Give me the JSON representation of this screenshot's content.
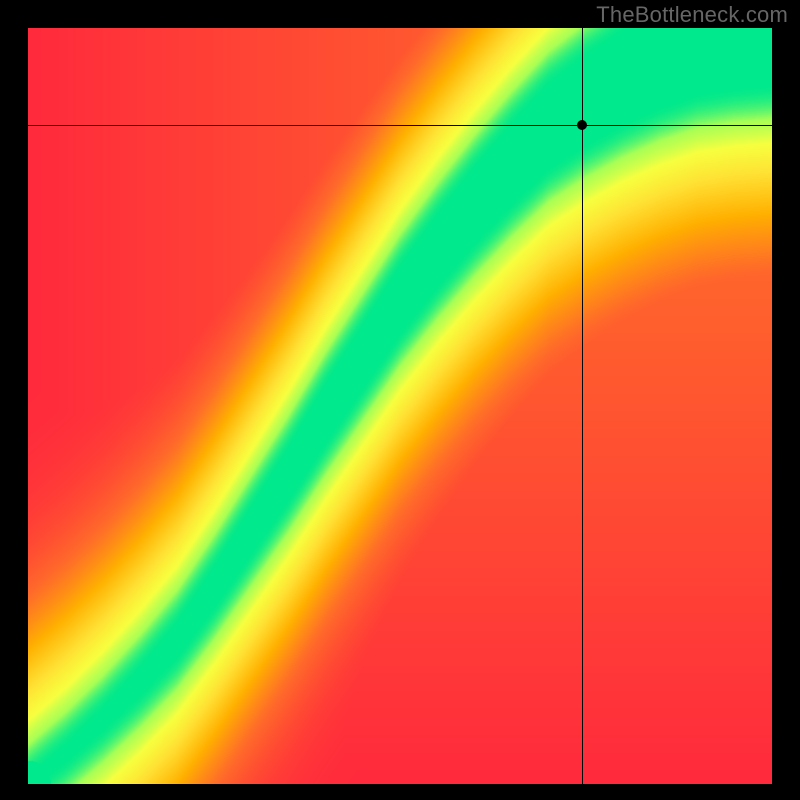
{
  "watermark": "TheBottleneck.com",
  "chart_data": {
    "type": "heatmap",
    "title": "",
    "xlabel": "",
    "ylabel": "",
    "xlim": [
      0,
      1
    ],
    "ylim": [
      0,
      1
    ],
    "crosshair": {
      "x": 0.745,
      "y": 0.872
    },
    "marker": {
      "x": 0.745,
      "y": 0.872
    },
    "optimal_ridge": [
      {
        "x": 0.0,
        "y": 0.0
      },
      {
        "x": 0.05,
        "y": 0.04
      },
      {
        "x": 0.1,
        "y": 0.085
      },
      {
        "x": 0.15,
        "y": 0.135
      },
      {
        "x": 0.2,
        "y": 0.19
      },
      {
        "x": 0.25,
        "y": 0.26
      },
      {
        "x": 0.3,
        "y": 0.335
      },
      {
        "x": 0.35,
        "y": 0.41
      },
      {
        "x": 0.4,
        "y": 0.49
      },
      {
        "x": 0.45,
        "y": 0.565
      },
      {
        "x": 0.5,
        "y": 0.64
      },
      {
        "x": 0.55,
        "y": 0.705
      },
      {
        "x": 0.6,
        "y": 0.765
      },
      {
        "x": 0.65,
        "y": 0.82
      },
      {
        "x": 0.7,
        "y": 0.87
      },
      {
        "x": 0.75,
        "y": 0.905
      },
      {
        "x": 0.8,
        "y": 0.935
      },
      {
        "x": 0.85,
        "y": 0.96
      },
      {
        "x": 0.9,
        "y": 0.98
      },
      {
        "x": 0.95,
        "y": 0.992
      },
      {
        "x": 1.0,
        "y": 1.0
      }
    ],
    "ridge_half_width": [
      {
        "x": 0.0,
        "w": 0.004
      },
      {
        "x": 0.1,
        "w": 0.01
      },
      {
        "x": 0.2,
        "w": 0.018
      },
      {
        "x": 0.3,
        "w": 0.026
      },
      {
        "x": 0.4,
        "w": 0.034
      },
      {
        "x": 0.5,
        "w": 0.04
      },
      {
        "x": 0.6,
        "w": 0.046
      },
      {
        "x": 0.7,
        "w": 0.052
      },
      {
        "x": 0.8,
        "w": 0.058
      },
      {
        "x": 0.9,
        "w": 0.064
      },
      {
        "x": 1.0,
        "w": 0.072
      }
    ],
    "color_stops": [
      {
        "t": 0.0,
        "color": "#ff2a3c"
      },
      {
        "t": 0.3,
        "color": "#ff6a2a"
      },
      {
        "t": 0.55,
        "color": "#ffb000"
      },
      {
        "t": 0.75,
        "color": "#ffe033"
      },
      {
        "t": 0.88,
        "color": "#f7ff3f"
      },
      {
        "t": 0.955,
        "color": "#a8ff55"
      },
      {
        "t": 1.0,
        "color": "#00e98c"
      }
    ],
    "legend": [],
    "grid": false
  }
}
